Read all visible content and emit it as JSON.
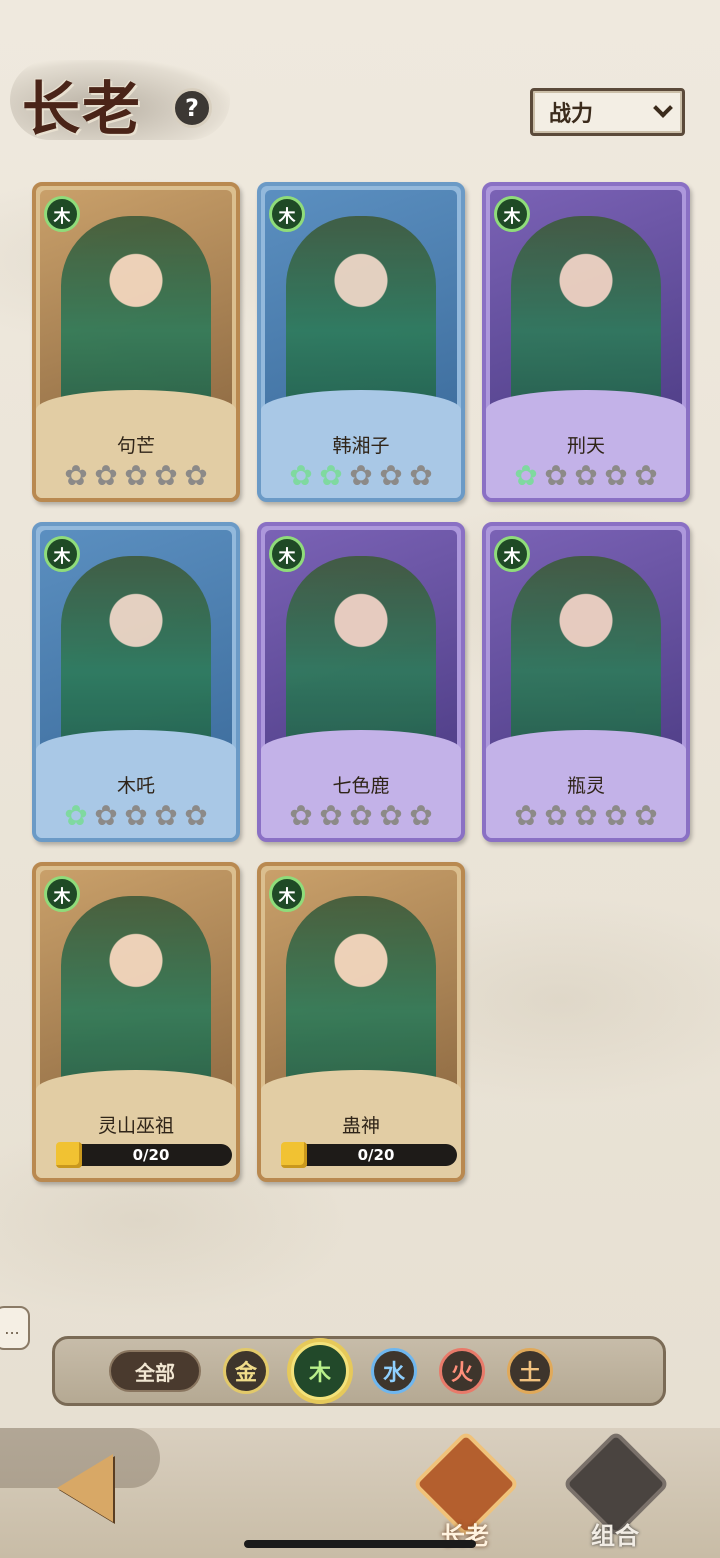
{
  "header": {
    "title": "长老",
    "help_icon": "question-icon",
    "sort_label": "战力"
  },
  "cards": [
    {
      "name": "句芒",
      "element": "木",
      "rarity": "gold",
      "stars_lit": 0,
      "stars_total": 5
    },
    {
      "name": "韩湘子",
      "element": "木",
      "rarity": "blue",
      "stars_lit": 2,
      "stars_total": 5
    },
    {
      "name": "刑天",
      "element": "木",
      "rarity": "purple",
      "stars_lit": 1,
      "stars_total": 5
    },
    {
      "name": "木吒",
      "element": "木",
      "rarity": "blue",
      "stars_lit": 1,
      "stars_total": 5
    },
    {
      "name": "七色鹿",
      "element": "木",
      "rarity": "purple",
      "stars_lit": 0,
      "stars_total": 5
    },
    {
      "name": "瓶灵",
      "element": "木",
      "rarity": "purple",
      "stars_lit": 0,
      "stars_total": 5
    },
    {
      "name": "灵山巫祖",
      "element": "木",
      "rarity": "gold",
      "progress": "0/20"
    },
    {
      "name": "蛊神",
      "element": "木",
      "rarity": "gold",
      "progress": "0/20"
    }
  ],
  "filters": {
    "all": "全部",
    "elements": [
      "金",
      "木",
      "水",
      "火",
      "土"
    ],
    "selected": "木"
  },
  "nav": {
    "tabs": [
      "长老",
      "组合"
    ],
    "active": "长老"
  },
  "side_chat": "..."
}
